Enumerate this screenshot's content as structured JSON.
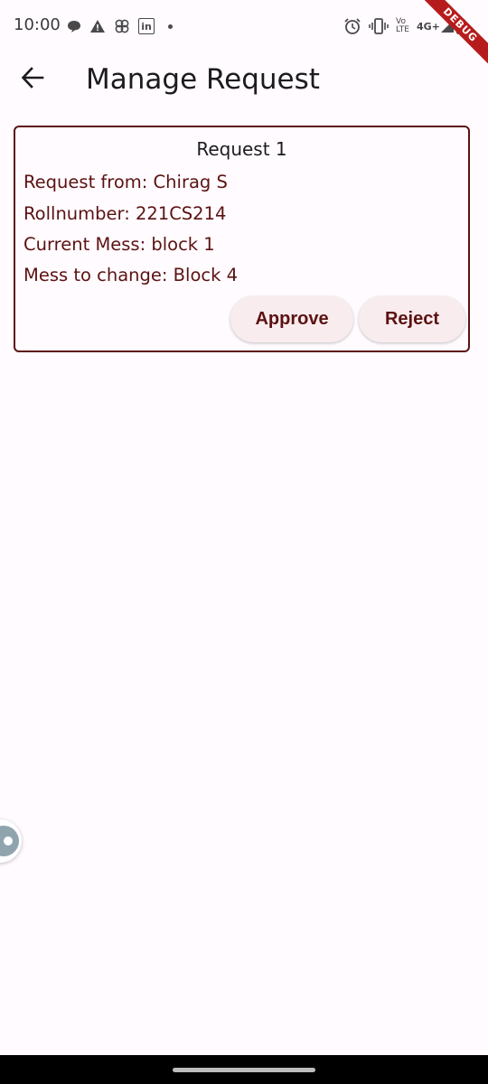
{
  "status_bar": {
    "time": "10:00",
    "left_icons": [
      "chat-bubble-icon",
      "warning-icon",
      "pinwheel-icon",
      "linkedin-icon",
      "dot-icon"
    ],
    "linkedin_text": "in",
    "right_icons": [
      "alarm-icon",
      "vibrate-icon",
      "volte-icon",
      "signal-icon",
      "battery-icon"
    ],
    "volte_line1": "Vo",
    "volte_line2": "LTE",
    "network": "4G+",
    "debug_label": "DEBUG"
  },
  "app_bar": {
    "back_icon": "arrow-left-icon",
    "title": "Manage Request"
  },
  "request": {
    "title": "Request 1",
    "from": "Request from: Chirag S",
    "roll": "Rollnumber: 221CS214",
    "current_mess": "Current Mess: block 1",
    "mess_to_change": "Mess to change: Block 4",
    "approve_label": "Approve",
    "reject_label": "Reject"
  },
  "colors": {
    "background": "#fffbff",
    "accent": "#5c1212",
    "button_bg": "#f8ecee",
    "debug_ribbon": "#b71c1c"
  }
}
